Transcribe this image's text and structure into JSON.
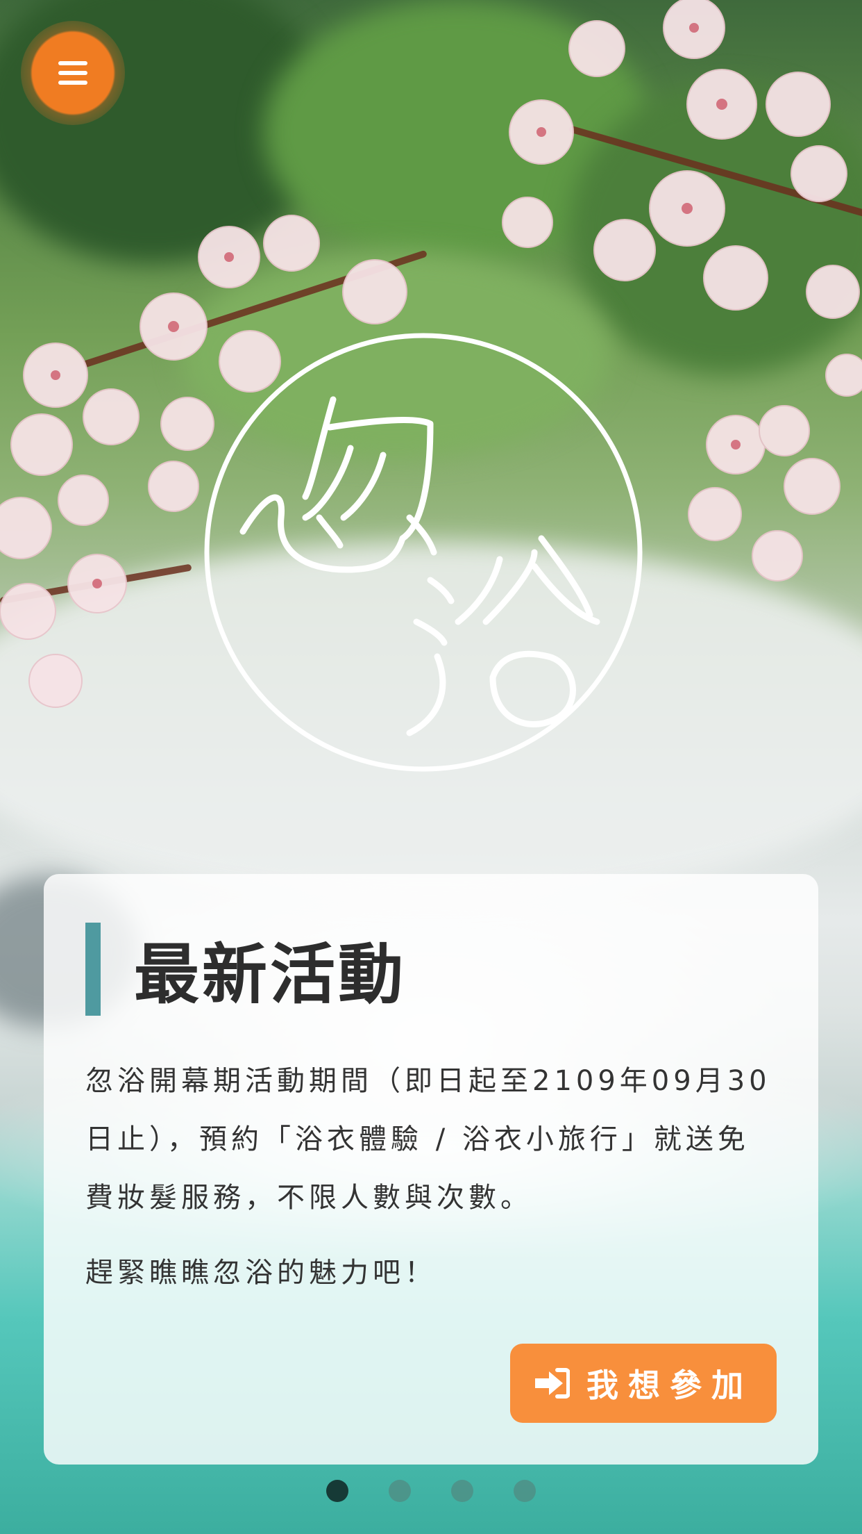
{
  "header": {
    "menu_icon": "hamburger-menu-icon"
  },
  "logo": {
    "text": "忽浴",
    "icon": "steam-bath-logo"
  },
  "news": {
    "title": "最新活動",
    "paragraph": "忽浴開幕期活動期間（即日起至2109年09月30日止），預約「浴衣體驗 / 浴衣小旅行」就送免費妝髮服務，不限人數與次數。",
    "paragraph2": "趕緊瞧瞧忽浴的魅力吧！",
    "button_label": "我想參加",
    "button_icon": "sign-in-arrow-icon"
  },
  "carousel": {
    "count": 4,
    "active_index": 0
  },
  "colors": {
    "accent": "#f88f3c",
    "menu": "#f07c22",
    "title_bar": "#4f9aa0"
  }
}
